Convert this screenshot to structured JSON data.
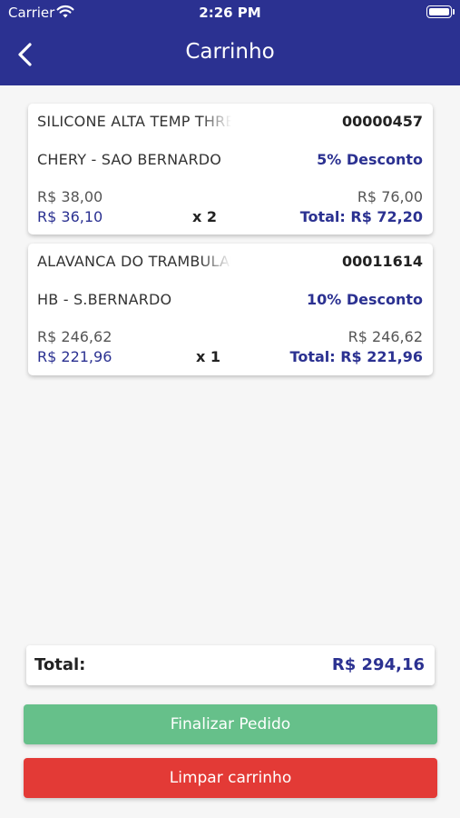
{
  "status_bar": {
    "carrier": "Carrier",
    "time": "2:26 PM"
  },
  "header": {
    "title": "Carrinho"
  },
  "cart_items": [
    {
      "name": "SILICONE ALTA TEMP THREE",
      "code": "00000457",
      "store": "CHERY - SAO BERNARDO",
      "discount": "5% Desconto",
      "unit_price": "R$ 38,00",
      "subtotal": "R$ 76,00",
      "unit_price_discounted": "R$ 36,10",
      "quantity": "x 2",
      "total": "Total: R$ 72,20"
    },
    {
      "name": "ALAVANCA DO TRAMBULADOR",
      "code": "00011614",
      "store": "HB - S.BERNARDO",
      "discount": "10% Desconto",
      "unit_price": "R$ 246,62",
      "subtotal": "R$ 246,62",
      "unit_price_discounted": "R$ 221,96",
      "quantity": "x 1",
      "total": "Total: R$ 221,96"
    }
  ],
  "summary": {
    "label": "Total:",
    "value": "R$ 294,16"
  },
  "actions": {
    "finish_label": "Finalizar Pedido",
    "clear_label": "Limpar carrinho"
  },
  "colors": {
    "primary": "#2b3191",
    "finish": "#66c08a",
    "clear": "#e33a36"
  }
}
